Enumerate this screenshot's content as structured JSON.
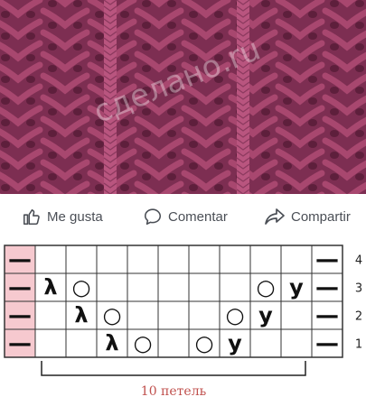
{
  "post": {
    "watermark": "сделано.ru",
    "actions": {
      "like_label": "Me gusta",
      "comment_label": "Comentar",
      "share_label": "Compartir"
    }
  },
  "pattern_chart": {
    "row_numbers": [
      "4",
      "3",
      "2",
      "1"
    ],
    "repeat_label": "10 петель",
    "colors": {
      "edge_cell": "#f6c9cf",
      "grid": "#333333",
      "symbol": "#111111",
      "repeat_label": "#c0504d",
      "yarn": "#a8476f"
    },
    "symbols": {
      "purl_edge": "—",
      "yarn_over": "○",
      "k2tog_left": "λ",
      "k2tog_right": "y"
    }
  }
}
